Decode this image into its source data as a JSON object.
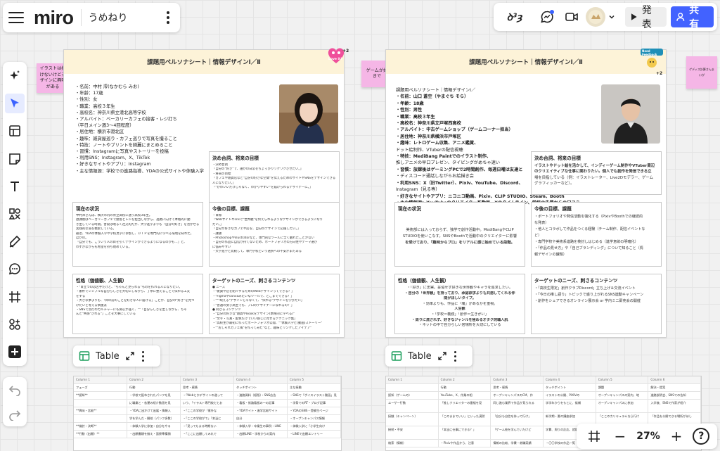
{
  "app": {
    "logo": "miro",
    "board_name": "うめねり"
  },
  "topbar": {
    "reactions_label": "ꝺ³ȝ",
    "present_label": "発表",
    "share_label": "共有"
  },
  "colors": {
    "accent": "#4262ff",
    "sticky": "#f5b6e6",
    "sheet_header": "#fdf3d8"
  },
  "left_toolbar": {
    "icons": [
      "sparkle-icon",
      "cursor-icon",
      "frame-template-icon",
      "sticky-note-icon",
      "text-icon",
      "shapes-icon",
      "pen-icon",
      "comment-icon",
      "frame-icon",
      "apps-icon",
      "plus-icon"
    ]
  },
  "stickies": {
    "left_note": [
      "イラストは描",
      "けないけどデ",
      "ザインに興味",
      "がある"
    ],
    "middle_note": "ゲームが好きで",
    "right_note": "ゲディス計算さんまいが"
  },
  "sheet1": {
    "title": "課題用ペルソナシート｜情報デザインⅠ／Ⅱ",
    "badge": "+2",
    "sticker": "Love it!",
    "info": [
      "・名前：中村 澪(なかむら みお)",
      "・年齢：17歳",
      "・性別：女",
      "・職業：高校３年生",
      "・高校名：神奈川県立港北高等学校",
      "・アルバイト：ベーカリーカフェの接客・レジ打ち",
      "（平日メイン週3〜4回程度）",
      "・居住地：横浜市港北区",
      "・趣味：雑貨屋巡り・カフェ巡りで写真を撮ること",
      "・特技：ノートやプリントを綺麗にまとめること",
      "・習慣：Instagramに写真やストーリーを投稿",
      "・利用SNS：Instagram、X、TikTok",
      "・好きなサイトやアプリ：Instagram",
      "・主な情報源：学校での進路指導、YDAの公式サイトや体験入学"
    ],
    "box_quote": {
      "title": "決め台詞、将来の目標",
      "lines": [
        "・決め台詞",
        "「自分の\"好き\"で、誰かの日常をちょっぴりワクワクさせたい。」",
        "・将来の目標",
        "「カフェや雑貨店など\"自分の好きな空間\"を伝えるためのサイトやSNSをデザインできる",
        "人になりたい。」",
        "「\"かわいいだけじゃなく、わかりやすい\"を届けられるデザイナーに。」"
      ]
    },
    "box_status": {
      "title": "現在の状況",
      "lines": [
        "中村澪さんは、横浜市内の県立高校に通う高校3年生。",
        "放課後はベーカリーカフェで接客とレジを担当しながら、進路に向けて本格的に動",
        "き出している時期。普段は明るく社交的だが、大学進学よりも「自分の好き」を活かせる",
        "実践的な道を模索している。",
        "最近、YDAの体験入学や学校見学に参加し、ＤＴＰを専門的に学べる環境を知れた。",
        "ほかの。",
        "「自分でも、こういう人の目を引くデザインができるようになるのかも…」と、",
        "わずかながらも希望を持ち始めている。"
      ]
    },
    "box_goal": {
      "title": "今後の目標、課題",
      "lines": [
        "・目標",
        "「Webサイトやsnsで\"世界観\"を伝えられるようなデザインができるようになり",
        "たい。」",
        "「自分が好きなカフェや店を、自分のデザインで応援したい。」",
        "・課題",
        "・Photoshopやillustratorなど、専門的なツールに全く触れたことがない",
        "・自分の作品に自信が持てないため、ポートフォリオの方向性やテーマ選び",
        "に悩みやすい",
        "・大学進学と比較して、専門学校という選択への不安がまだある"
      ]
    },
    "box_personality": {
      "title": "性格（価値観、人生観）",
      "lines": [
        "・\"目立つのは苦手だけど、\"ちゃんと見られる\"ものを作れる人になりたい。",
        "・素朴でシンプルな自分らしさを大切にしながら、丁寧に整えることで伝わる工夫",
        "をする",
        "・大きな夢よりも、「目の前のことを好きな人に届ける」ことが、自分の\"好き\"を見つ",
        "けたいと考える慎重派",
        "・SNSで流行のカルチャーにも関心が強く、\"\"「自分らしさを出しながら、ちゃ",
        "んと\"共感\"される\"」ことを大事にしている"
      ]
    },
    "box_needs": {
      "title": "ターゲットのニーズ、刺さるコンテンツ",
      "lines": [
        "● ニーズ",
        "・\"雑貨や店を紹介するためのWebデザインってできる？」",
        "・\"Figmaやcanvaみたいなツールで、どこまでできる？」",
        "・\"\"\"映える\"デザインじゃなくて、\"伝わる\"デザインを学びたい」",
        "・\"普通の女子高生でも、プロのデザイナーになれるの？」",
        "● 刺さるコンテンツ",
        "・\"自分の好きな\"雑貨やBookをデザイン(本格的に学べる)\"",
        "・\"文字・写真・配色だけでいい感じに見せるテクニック集」",
        "・\"高校生が最初に作ったポートフォリオ公開、\"\"体験入学ビ(動画)ストーリー\"",
        "・\"\"おしゃれカフェ風\"を作ってみた\"など、趣味とリンクしたアイデア\""
      ]
    }
  },
  "sheet2": {
    "title": "課題用ペルソナシート｜情報デザインⅠ／Ⅱ",
    "badge": "+2",
    "sticker": "Need Feedback",
    "info": [
      "課題用ペルソナシート｜情報デザインⅠ／",
      "・名前：山口 蒼空（やまぐち そら）",
      "・年齢：18歳",
      "・性別：男性",
      "・職業：高校３年生",
      "・高校名：神奈川県立戸塚西高校",
      "・アルバイト：中古ゲームショップ（ゲームコーナー担当）",
      "・居住地：神奈川県横浜市戸塚区",
      "・趣味：レトロゲーム収集、アニメ鑑賞、",
      "ドット絵制作、VTuberの配信視聴",
      "・特技：MediBang Paintでのイラスト制作、",
      "推しアニメの早口プレゼン、タイピングがめちゃ速い",
      "・習慣：放課後はゲーミングPCで2時間創作、毎週日曜は友達と",
      "・ディスコード通話しながらお絵描き会",
      "・利用SNS：X（旧Twitter）、Pixiv、YouTube、Discord、",
      "Instagram（見る専）",
      "・好きなサイトやアプリ：ニコニコ動画、Pixiv、CLIP STUDIO、Steam、Booth",
      "・主な情報源：YouTubeのクリエイター系動画、Xのタイムライン、学校の先輩からの口コミ"
    ],
    "box_quote": {
      "title": "決め台詞、将来の目標",
      "lines": [
        "イラストやドット絵を活かして、インディーゲーム制作やVTuber周辺",
        "のクリエイティブな仕事に関わりたい。個人でも創作を発信できる立",
        "場を目指している（例：イラストレーター、Live2Dモデラー、ゲーム",
        "グラフィッカーなど）。"
      ]
    },
    "box_status": {
      "title": "現在の状況",
      "lines": [
        "美術部には入っておらず、独学で創作活動中。MediBangやCLIP",
        "STUDIOを使いこなす。SNSやBoothで活動中のクリエイターに影響",
        "を受けており、「趣味からプロ」をリアルに感じ始めている段階。"
      ]
    },
    "box_goal": {
      "title": "今後の目標、課題",
      "lines": [
        "・ポートフォリオや発信活動を強化する（PixivやBoothでの継続的",
        "な発表）",
        "・他人とコラボして作品をつくる経験（チーム制作、配信イベントな",
        "ど）",
        "・専門学校や美術系進路を検討しはじめる（進学意欲の明確化）",
        "・「作品の見せ方」や「自己ブランディング」について知ること（情",
        "報デザインの課題）"
      ]
    },
    "box_personality": {
      "title": "性格（価値観、人生観）",
      "lines": [
        "・「好き」に忠実。妥協せず好きな世界観やキャラを追求したい。",
        "",
        "・自分の「世界観」を持っており、承認欲求よりも共感してくれる仲",
        "間がほしいタイプ。",
        "・効率よりも、作品に「魂」があるかを重視。",
        "人生観",
        "・「学校＝義務」「創作＝生きがい」",
        "・周りに流されず、好きなジャンルを極めるオタク的職人肌",
        "・ネットの中で自分らしい居場所を大切にしている"
      ]
    },
    "box_needs": {
      "title": "ターゲットのニーズ、刺さるコンテンツ",
      "lines": [
        "",
        "・「高校生限定」創作クラブDiscord」立ち上げ＆交流イベント",
        "",
        "・「今日の推し語り」トピックで盛り上がれるSNS連動キャンペーン",
        "・創作をシェアできるオンライン展示会 or 学内ミニ即売会の開催"
      ]
    }
  },
  "table_toolbar": {
    "label": "Table"
  },
  "table1": {
    "headers": [
      "Column 1",
      "Column 2",
      "Column 3",
      "Column 4",
      "Column 5"
    ],
    "rows": [
      [
        "フェーズ",
        "行動",
        "思考・感情",
        "タッチポイント",
        "主な接触"
      ],
      [
        "**認知**",
        "・学校で配布されたパンフを見",
        "・「Webとかデザインの道って",
        "・進路資料（紙版）・SNS広告",
        "・SNSで「ボイスイラスト動画」見"
      ],
      [
        "",
        "に職業と・各運の紹介動画を見",
        "いう、「イラスト専門校だとお",
        "・看板・街路看板の〜の記事",
        "・学祭でのRT・ブログ記事"
      ],
      [
        "**興味・比較**",
        "・YDAに出かけて出展・情報入",
        "・「ここの学校が「意外な",
        "・YDAサイト・進学比較サイト",
        "・YDAのSNS・受験生ページ"
      ],
      [
        "",
        "学を学んだ・開校（パンフ多数）",
        "・「ここの学校がで」「本当に",
        "自分",
        "・オープンキャンパス情報"
      ],
      [
        "**検討・決断**",
        "・体験入学に参加・自分をやる",
        "・「見ってもまる時期ない",
        "・体験入学・卒業生の事例・LINE",
        "・体験入学に「小学生向け",
        "連絡"
      ],
      [
        "**行動（出願）**",
        "・出願書類を揃え・面接準備開",
        "・「ここに出願してみれで",
        "・出願LINE・学校からの案内",
        "・LINEで出願エントリー"
      ]
    ]
  },
  "table2": {
    "headers": [
      "Column 1",
      "Column 2",
      "Column 3",
      "Column 4",
      "Column 5",
      "Column 6"
    ],
    "rows": [
      [
        "",
        "行動",
        "思考・感情",
        "タッチポイント",
        "課題",
        "解決・提案"
      ],
      [
        "認知（ゲームの）",
        "YouTube、X、作業の相",
        "オープンキャンパスのCM、作",
        "イラストの公開、PIXIVの",
        "オープンキャンパスの案内、地",
        "進路説明会、SNSでの告知"
      ],
      [
        "ユーザー行動",
        "「推しクリエイターの番組を見",
        "同じ進む業界で作品が見られる",
        "学学年からをもとに、候補",
        "オープンキャンパスに参加",
        "入学後、SNSで作家が紹介"
      ],
      [
        "接触（キャンペーン）",
        "「このままでいい」といった漠然",
        "「自分も自信を持って行け」",
        "新学期・夏の講座参加",
        "「ここのカリキュラムなら行け",
        "「作品を公開できる場所がほし"
      ],
      [
        "接続・不安",
        "「本当に仕事にできる？」",
        "「ゲーム絵を学んでいたけど",
        "学費、周りの反応、就職実績",
        "体験入学で本格的な制作を実感",
        "イベントで作品を展示"
      ],
      [
        "検索（情報）",
        "・Pixivや作品から、注意",
        "情報の比較、学費・就職実績",
        "・〇〇学校の作品一覧",
        "・XのTLで先輩の動画を見",
        "・SNS投稿の反応を確認"
      ]
    ]
  },
  "zoom": {
    "value": "27%",
    "minus_label": "−",
    "plus_label": "+",
    "help_label": "?"
  }
}
